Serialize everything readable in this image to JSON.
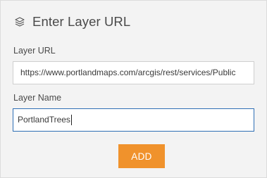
{
  "header": {
    "icon": "layers-icon",
    "title": "Enter Layer URL"
  },
  "layer_url": {
    "label": "Layer URL",
    "value": "https://www.portlandmaps.com/arcgis/rest/services/Public"
  },
  "layer_name": {
    "label": "Layer Name",
    "value": "PortlandTrees"
  },
  "actions": {
    "add_label": "ADD"
  },
  "colors": {
    "accent": "#f0922c",
    "focus_border": "#2e6fb5",
    "panel_bg": "#f3f3f3"
  }
}
